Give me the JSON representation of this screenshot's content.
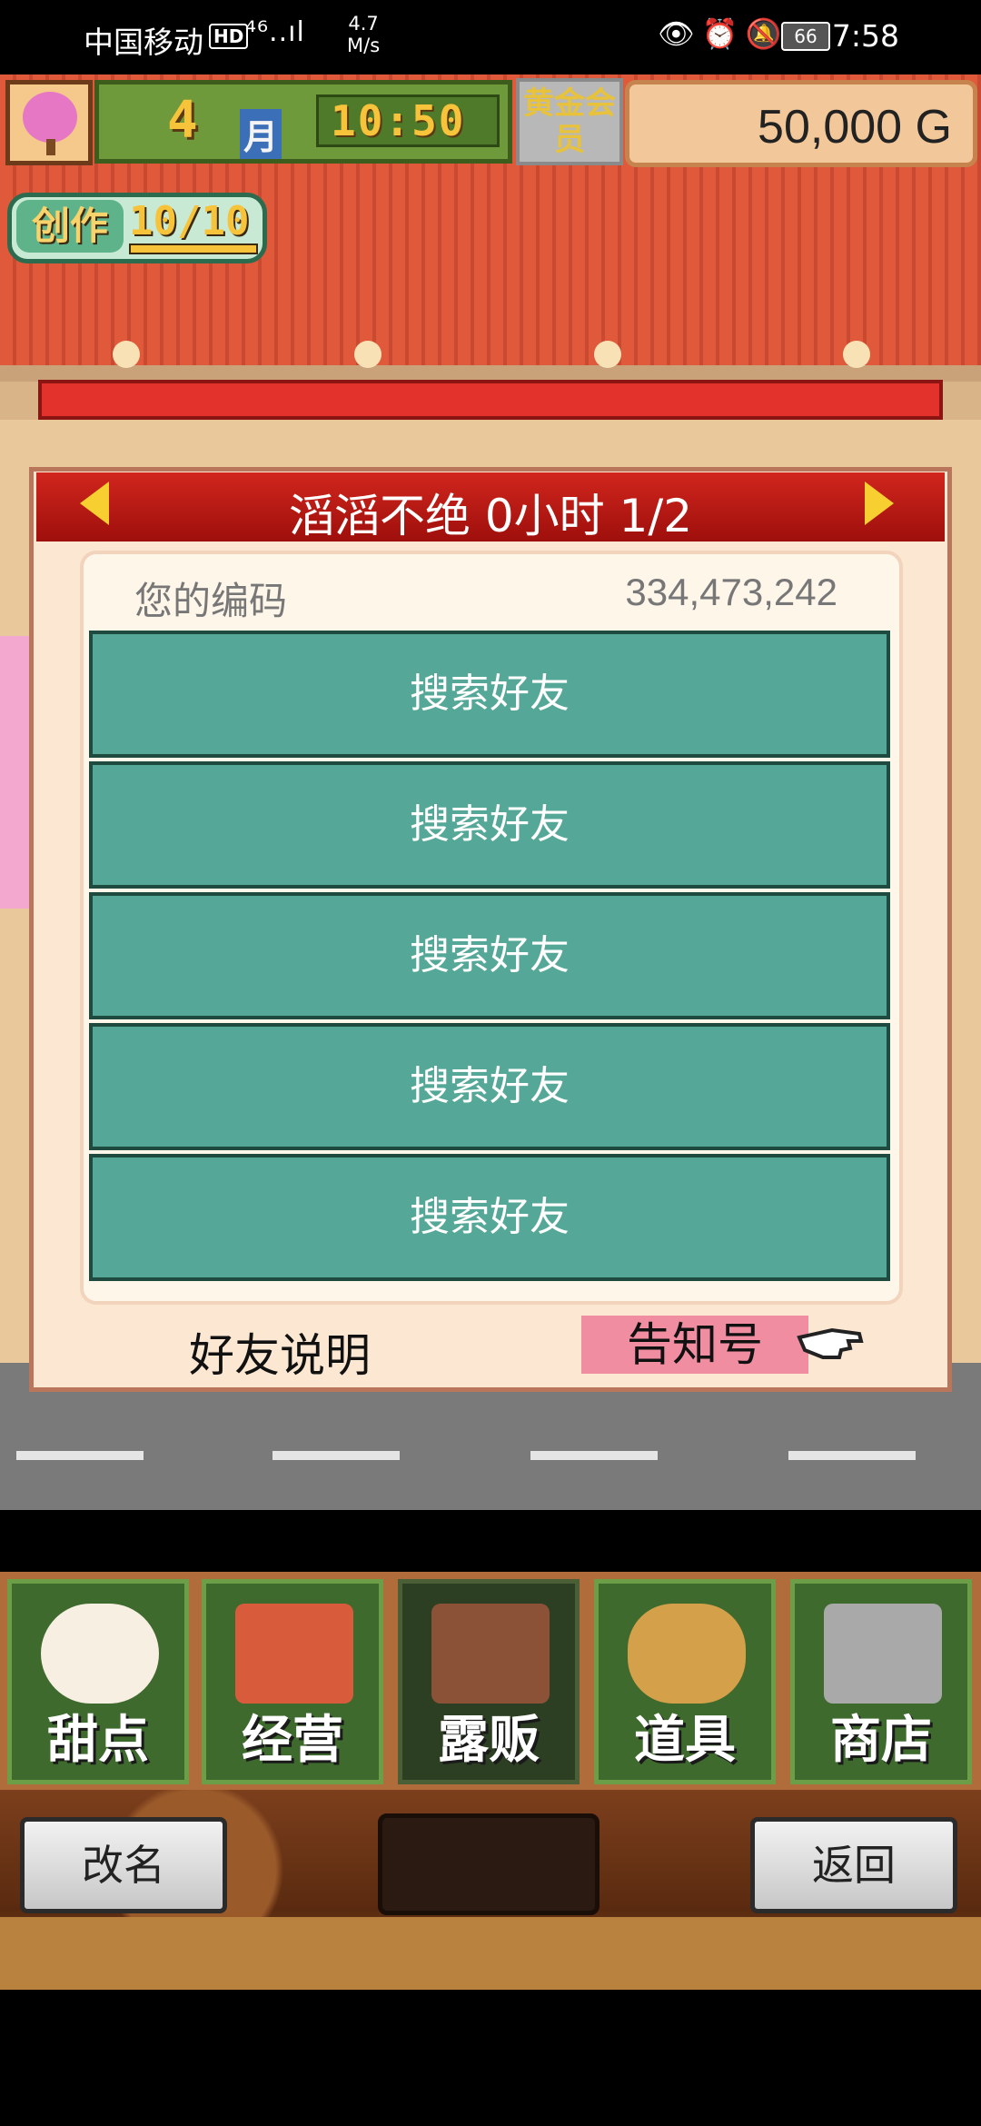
{
  "status_bar": {
    "carrier": "中国移动",
    "hd": "HD",
    "signal": "⁴⁶..ıl",
    "speed_value": "4.7",
    "speed_unit": "M/s",
    "battery": "66",
    "time": "7:58"
  },
  "hud": {
    "month": "4",
    "month_unit": "月",
    "clock": "10:50",
    "gold_member": "黄金会员",
    "money": "50,000 G",
    "create_label": "创作",
    "create_count": "10/10"
  },
  "dialog": {
    "title": "滔滔不绝  0小时 1/2",
    "code_label": "您的编码",
    "code_value": "334,473,242",
    "friend_slots": [
      "搜索好友",
      "搜索好友",
      "搜索好友",
      "搜索好友",
      "搜索好友"
    ],
    "info_label": "好友说明",
    "notify_label": "告知号"
  },
  "menu": {
    "items": [
      {
        "label": "甜点",
        "icon": "cake-icon"
      },
      {
        "label": "经营",
        "icon": "shop-icon"
      },
      {
        "label": "露贩",
        "icon": "food-truck-icon"
      },
      {
        "label": "道具",
        "icon": "items-bag-icon"
      },
      {
        "label": "商店",
        "icon": "cart-icon"
      }
    ],
    "active_index": 2
  },
  "bottom": {
    "rename": "改名",
    "back": "返回"
  }
}
